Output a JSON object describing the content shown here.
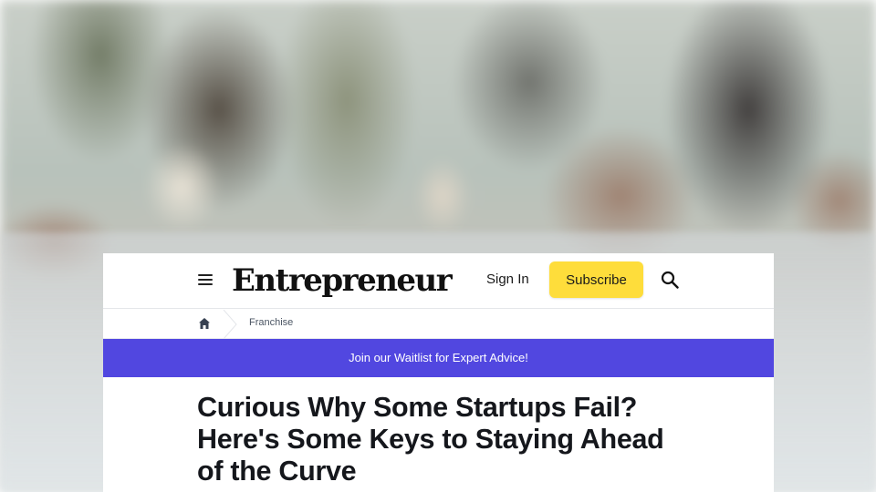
{
  "header": {
    "logo_text": "Entrepreneur",
    "signin_label": "Sign In",
    "subscribe_label": "Subscribe",
    "icons": [
      "menu-icon",
      "search-icon"
    ]
  },
  "breadcrumb": {
    "home_icon": "home-icon",
    "items": [
      "Franchise"
    ]
  },
  "banner": {
    "text": "Join our Waitlist for Expert Advice!",
    "color": "#5147e0"
  },
  "article": {
    "headline": "Curious Why Some Startups Fail? Here's Some Keys to Staying Ahead of the Curve"
  },
  "colors": {
    "subscribe_bg": "#fedd3b",
    "headline_text": "#15171c"
  }
}
